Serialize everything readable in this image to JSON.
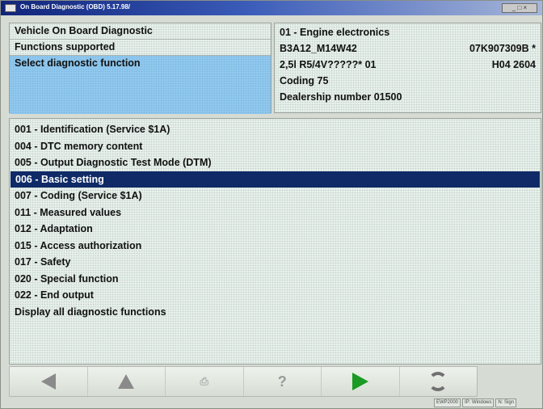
{
  "window": {
    "title": "On Board Diagnostic (OBD) 5.17.98/"
  },
  "header_left": {
    "rows": [
      {
        "label": "Vehicle On Board Diagnostic"
      },
      {
        "label": "Functions supported"
      },
      {
        "label": "Select diagnostic function"
      }
    ]
  },
  "header_right": {
    "module": "01 - Engine electronics",
    "part_left": "B3A12_M14W42",
    "part_right": "07K907309B *",
    "engine_left": "2,5l R5/4V?????* 01",
    "engine_right": "H04 2604",
    "coding": "Coding 75",
    "dealership": "Dealership number 01500"
  },
  "functions": {
    "selected_index": 3,
    "items": [
      "001 - Identification (Service $1A)",
      "004 - DTC memory content",
      "005 - Output Diagnostic Test Mode (DTM)",
      "006 - Basic setting",
      "007 - Coding (Service $1A)",
      "011 - Measured values",
      "012 - Adaptation",
      "015 - Access authorization",
      "017 - Safety",
      "020 - Special function",
      "022 - End output",
      "Display all diagnostic functions"
    ]
  },
  "toolbar": {
    "buttons": [
      {
        "icon": "arrow-left-icon"
      },
      {
        "icon": "arrow-up-icon"
      },
      {
        "icon": "print-icon"
      },
      {
        "icon": "help-icon",
        "glyph": "?"
      },
      {
        "icon": "play-icon"
      },
      {
        "icon": "refresh-icon"
      }
    ]
  },
  "status": {
    "cells": [
      "EWP2000",
      "IP: Windows",
      "N: Sign"
    ]
  },
  "colors": {
    "selection": "#0f2a66",
    "play_green": "#1b9a24",
    "panel_blue": "#90c8ee"
  }
}
